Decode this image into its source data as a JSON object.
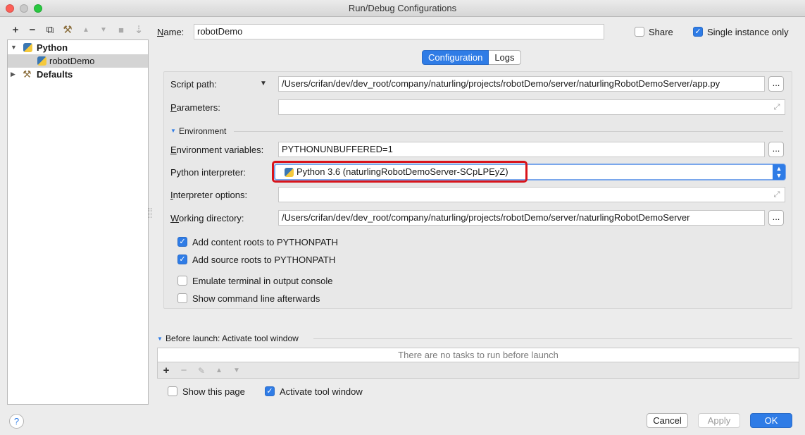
{
  "window": {
    "title": "Run/Debug Configurations",
    "traffic_colors": {
      "close": "#fd5f57",
      "minimize": "#febc2e",
      "zoom": "#28c840"
    }
  },
  "toolbar": {
    "add": "+",
    "remove": "−",
    "copy": "⧉",
    "wrench": "⚒",
    "up": "▲",
    "down": "▼",
    "folder": "■",
    "sort": "⇣"
  },
  "tree": {
    "python_label": "Python",
    "robotdemo_label": "robotDemo",
    "defaults_label": "Defaults",
    "expanded_arrow": "▼",
    "collapsed_arrow": "▶"
  },
  "header": {
    "name_label_u": "N",
    "name_label_rest": "ame:",
    "name_value": "robotDemo",
    "share_label": "Share",
    "share_checked": false,
    "single_instance_label": "Single instance only",
    "single_instance_checked": true
  },
  "tabs": {
    "configuration": "Configuration",
    "logs": "Logs"
  },
  "form": {
    "script_path_label": "Script path:",
    "script_path_value": "/Users/crifan/dev/dev_root/company/naturling/projects/robotDemo/server/naturlingRobotDemoServer/app.py",
    "parameters_label_u": "P",
    "parameters_label_rest": "arameters:",
    "parameters_value": "",
    "environment_section": "Environment",
    "env_vars_label_u": "E",
    "env_vars_label_rest": "nvironment variables:",
    "env_vars_value": "PYTHONUNBUFFERED=1",
    "interpreter_label": "Python interpreter:",
    "interpreter_value": "Python 3.6 (naturlingRobotDemoServer-SCpLPEyZ)",
    "interp_options_label_u": "I",
    "interp_options_label_rest": "nterpreter options:",
    "interp_options_value": "",
    "working_dir_label_u": "W",
    "working_dir_label_rest": "orking directory:",
    "working_dir_value": "/Users/crifan/dev/dev_root/company/naturling/projects/robotDemo/server/naturlingRobotDemoServer",
    "browse": "...",
    "checkboxes": [
      {
        "label": "Add content roots to PYTHONPATH",
        "checked": true
      },
      {
        "label": "Add source roots to PYTHONPATH",
        "checked": true
      },
      {
        "label": "Emulate terminal in output console",
        "checked": false
      },
      {
        "label": "Show command line afterwards",
        "checked": false
      }
    ]
  },
  "before_launch": {
    "title": "Before launch: Activate tool window",
    "empty_text": "There are no tasks to run before launch",
    "add": "+",
    "remove": "−",
    "edit": "✎",
    "up": "▲",
    "down": "▼",
    "show_page_label": "Show this page",
    "show_page_checked": false,
    "activate_label": "Activate tool window",
    "activate_checked": true
  },
  "footer": {
    "help": "?",
    "cancel": "Cancel",
    "apply": "Apply",
    "ok": "OK"
  },
  "colors": {
    "accent": "#2f7ce6",
    "highlight_border": "#d9141b"
  }
}
